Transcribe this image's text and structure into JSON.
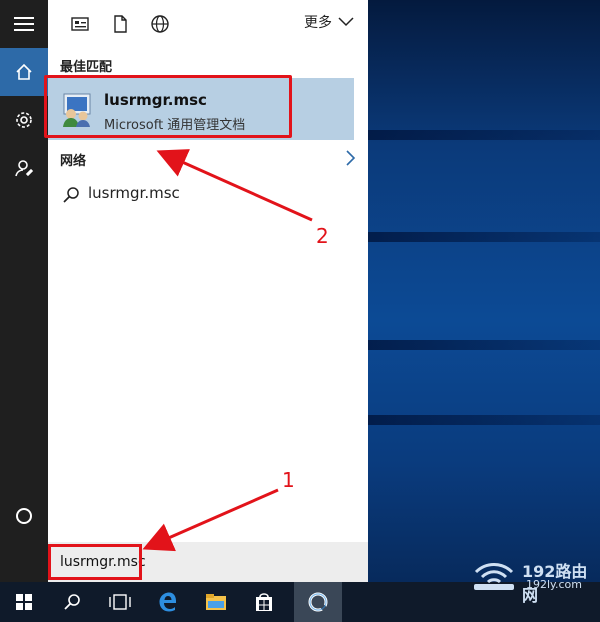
{
  "start_menu": {
    "more_label": "更多",
    "best_match_header": "最佳匹配",
    "best_match": {
      "title": "lusrmgr.msc",
      "subtitle": "Microsoft 通用管理文档"
    },
    "network_header": "网络",
    "web_suggestion": "lusrmgr.msc",
    "rail_icons": [
      "hamburger-icon",
      "home-icon",
      "settings-icon",
      "feedback-icon",
      "cortana-icon"
    ],
    "top_icons": [
      "app-list-icon",
      "document-icon",
      "globe-icon"
    ]
  },
  "search": {
    "query": "lusrmgr.msc"
  },
  "annotations": {
    "step1": "1",
    "step2": "2"
  },
  "taskbar": {
    "items": [
      "windows-start-icon",
      "search-icon",
      "task-view-icon",
      "edge-icon",
      "file-explorer-icon",
      "store-icon",
      "cortana-app-icon"
    ]
  },
  "watermark": {
    "brand": "192路由网",
    "site": "192ly.com"
  },
  "colors": {
    "highlight": "#b7cfe3",
    "annotation_red": "#e2131a",
    "rail": "#1f1f1f",
    "taskbar": "#0f1a2a"
  }
}
